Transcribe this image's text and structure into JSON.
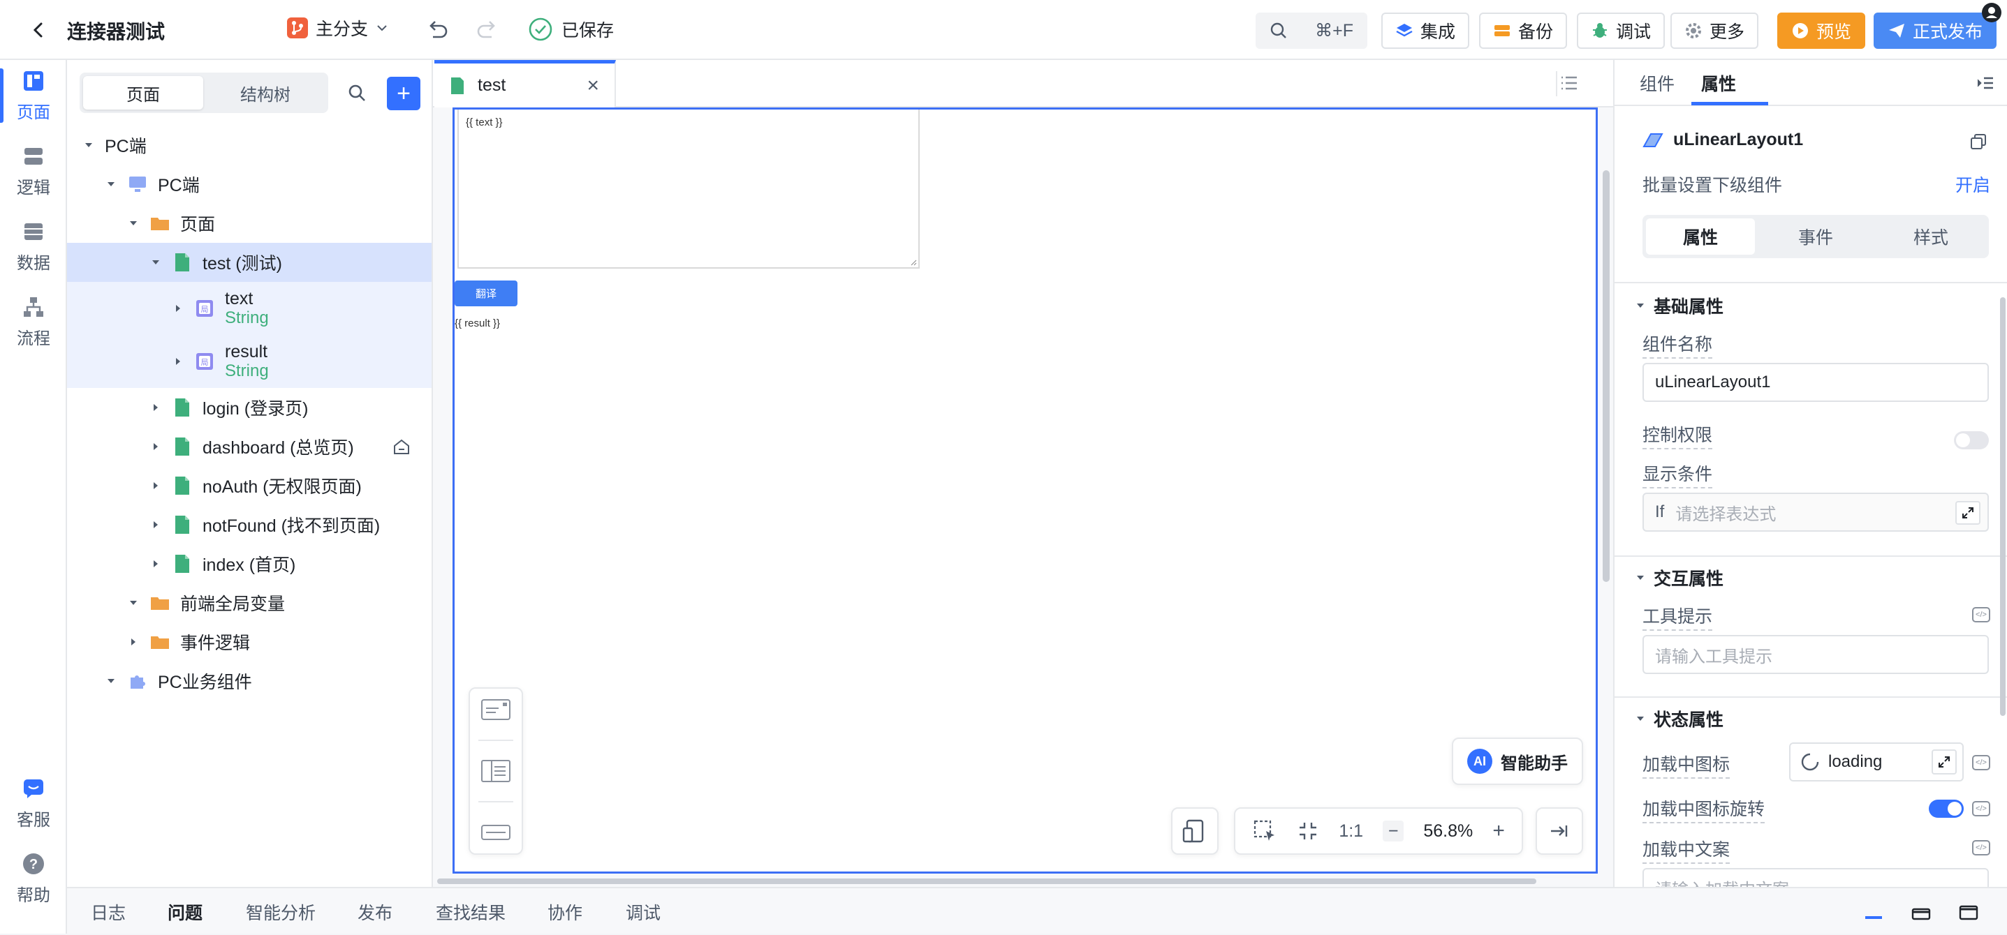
{
  "topbar": {
    "back_label": "<",
    "app_title": "连接器测试",
    "branch_label": "主分支",
    "saved_label": "已保存",
    "search_shortcut": "⌘+F",
    "integrate_label": "集成",
    "backup_label": "备份",
    "debug_label": "调试",
    "more_label": "更多",
    "preview_label": "预览",
    "publish_label": "正式发布"
  },
  "rail": {
    "items": [
      {
        "label": "页面"
      },
      {
        "label": "逻辑"
      },
      {
        "label": "数据"
      },
      {
        "label": "流程"
      }
    ],
    "bottom_items": [
      {
        "label": "客服"
      },
      {
        "label": "帮助"
      }
    ]
  },
  "tree": {
    "tab_page": "页面",
    "tab_structure": "结构树",
    "add_label": "+",
    "rows": [
      {
        "label": "PC端"
      },
      {
        "label": "PC端"
      },
      {
        "label": "页面"
      },
      {
        "label": "test (测试)"
      },
      {
        "label": "text",
        "type": "String"
      },
      {
        "label": "result",
        "type": "String"
      },
      {
        "label": "login (登录页)"
      },
      {
        "label": "dashboard (总览页)"
      },
      {
        "label": "noAuth (无权限页面)"
      },
      {
        "label": "notFound (找不到页面)"
      },
      {
        "label": "index (首页)"
      },
      {
        "label": "前端全局变量"
      },
      {
        "label": "事件逻辑"
      },
      {
        "label": "PC业务组件"
      }
    ]
  },
  "editor": {
    "tab_label": "test",
    "close_label": "×",
    "canvas_text_binding": "{{ text }}",
    "canvas_button": "翻译",
    "canvas_result_binding": "{{ result }}",
    "ai_badge": "AI",
    "ai_assistant_label": "智能助手",
    "ratio_label": "1:1",
    "zoom_minus": "−",
    "zoom_value": "56.8%",
    "zoom_plus": "+"
  },
  "bottombar": {
    "tabs": [
      "日志",
      "问题",
      "智能分析",
      "发布",
      "查找结果",
      "协作",
      "调试"
    ],
    "active_tab": "问题"
  },
  "rpanel": {
    "tab_component": "组件",
    "tab_properties": "属性",
    "component_name": "uLinearLayout1",
    "batch_label": "批量设置下级组件",
    "batch_action": "开启",
    "seg_properties": "属性",
    "seg_events": "事件",
    "seg_style": "样式",
    "basic_section": "基础属性",
    "name_label": "组件名称",
    "name_value": "uLinearLayout1",
    "permission_label": "控制权限",
    "condition_label": "显示条件",
    "condition_prefix": "If",
    "condition_placeholder": "请选择表达式",
    "interaction_section": "交互属性",
    "tooltip_label": "工具提示",
    "tooltip_placeholder": "请输入工具提示",
    "state_section": "状态属性",
    "loading_icon_label": "加载中图标",
    "loading_icon_value": "loading",
    "loading_rotate_label": "加载中图标旋转",
    "loading_text_label": "加载中文案",
    "loading_text_placeholder": "请输入加载中文案"
  },
  "colors": {
    "accent": "#3370ff",
    "selected_row": "#d7e2fd",
    "preview": "#f59a23",
    "publish": "#4a8af4",
    "page_icon": "#3eaf7c",
    "folder_icon": "#f0a044"
  }
}
